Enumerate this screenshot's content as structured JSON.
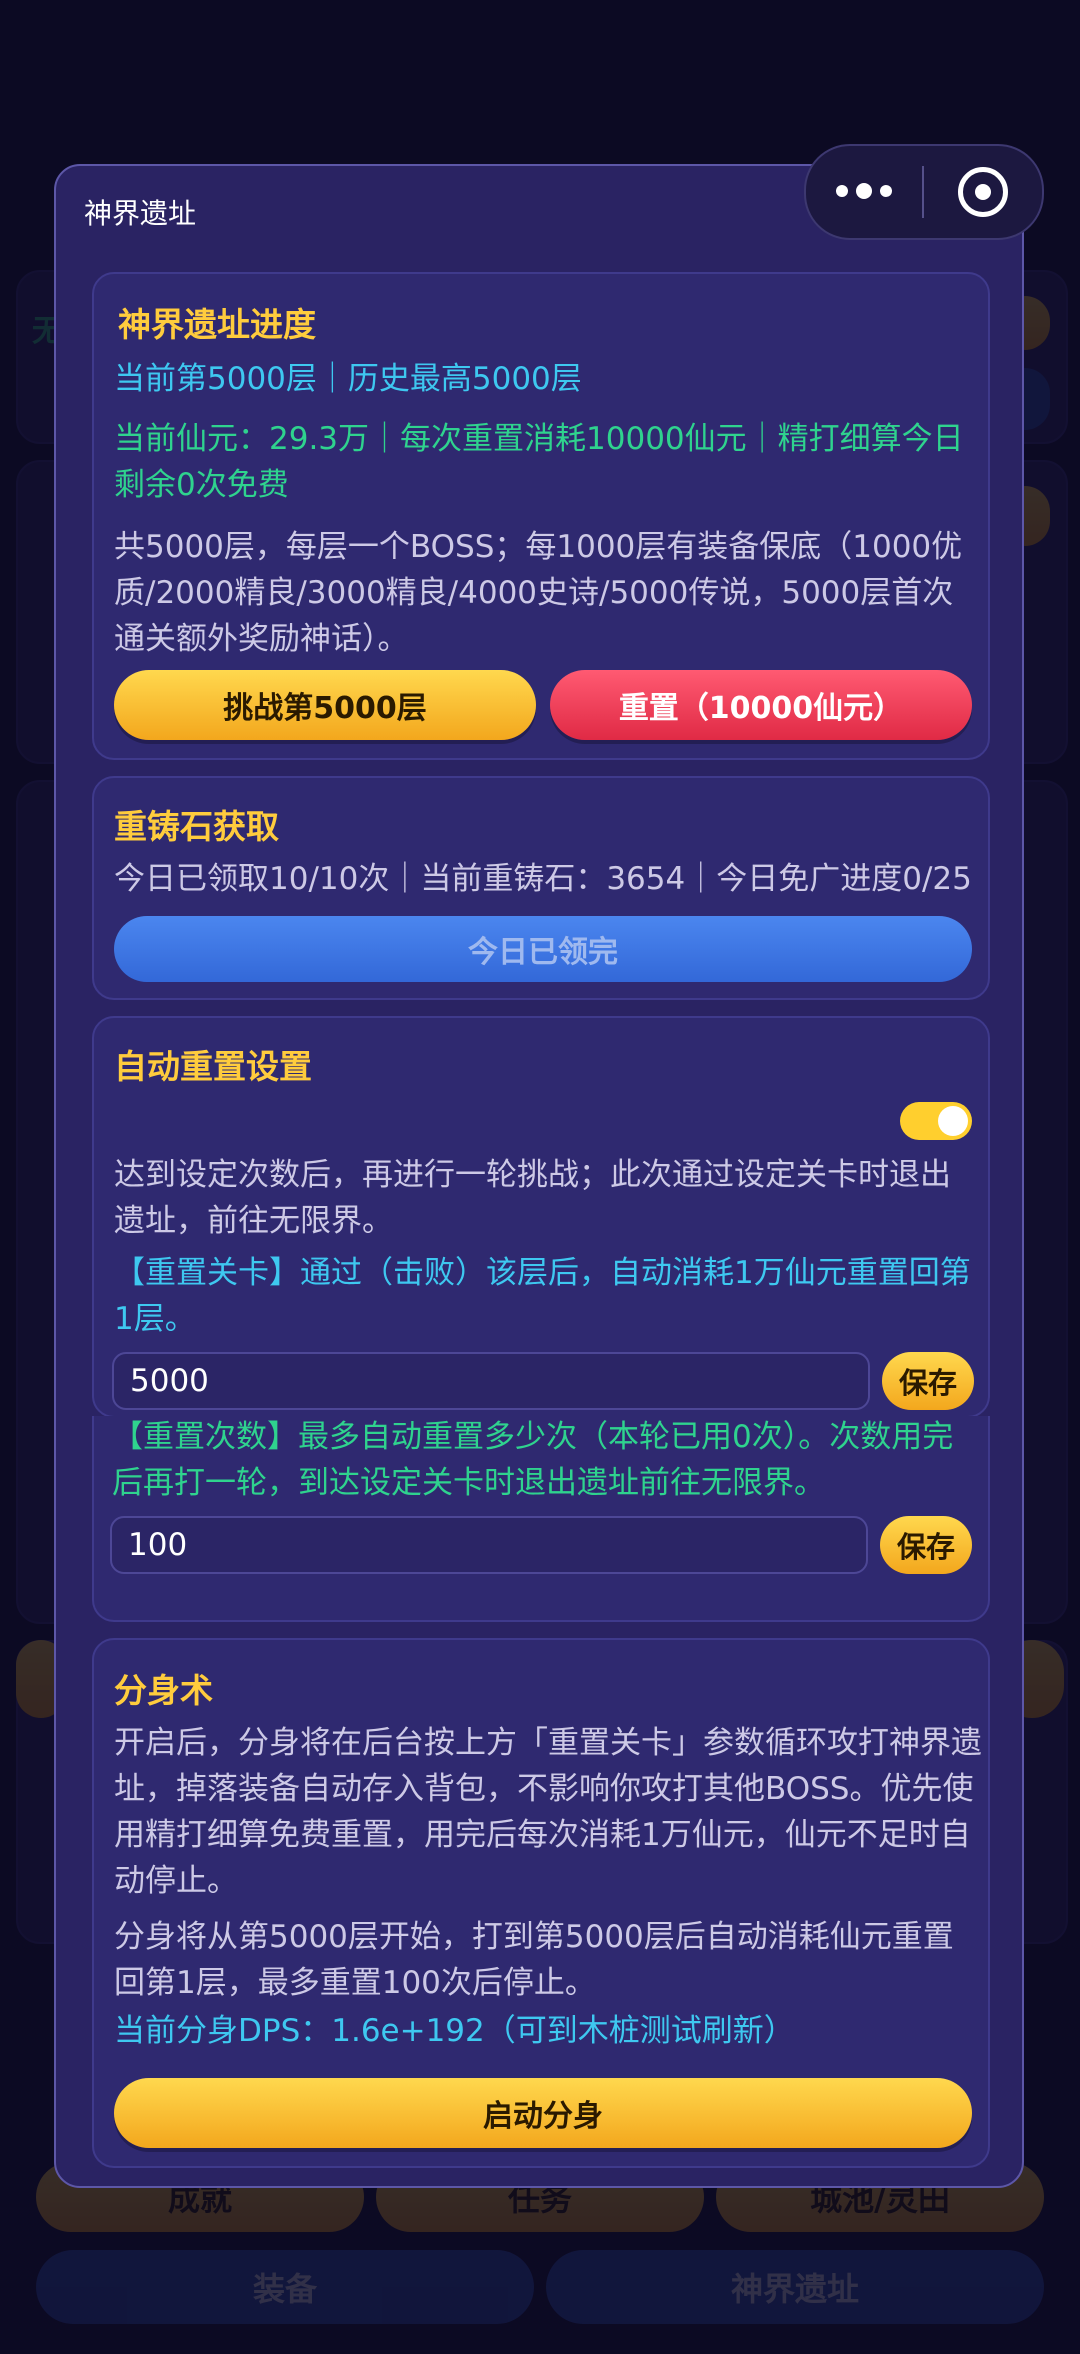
{
  "background": {
    "peek_left_top": "无",
    "bottom_row_1": [
      "成就",
      "任务",
      "城池/灵田"
    ],
    "bottom_row_2": [
      "装备",
      "神界遗址"
    ]
  },
  "capsule": {
    "more_icon": "more-dots-icon",
    "close_icon": "target-close-icon"
  },
  "modal": {
    "title": "神界遗址",
    "progress": {
      "title": "神界遗址进度",
      "floor_line": "当前第5000层｜历史最高5000层",
      "currency_line": "当前仙元：29.3万｜每次重置消耗10000仙元｜精打细算今日剩余0次免费",
      "desc": "共5000层，每层一个BOSS；每1000层有装备保底（1000优质/2000精良/3000精良/4000史诗/5000传说，5000层首次通关额外奖励神话）。",
      "challenge_button": "挑战第5000层",
      "reset_button": "重置（10000仙元）"
    },
    "reforge": {
      "title": "重铸石获取",
      "info_line": "今日已领取10/10次｜当前重铸石：3654｜今日免广进度0/25",
      "claim_button": "今日已领完"
    },
    "auto_reset": {
      "title": "自动重置设置",
      "toggle_on": true,
      "desc": "达到设定次数后，再进行一轮挑战；此次通过设定关卡时退出遗址，前往无限界。",
      "stage_desc": "【重置关卡】通过（击败）该层后，自动消耗1万仙元重置回第1层。",
      "stage_value": "5000",
      "save_label_1": "保存",
      "count_desc": "【重置次数】最多自动重置多少次（本轮已用0次）。次数用完后再打一轮，到达设定关卡时退出遗址前往无限界。",
      "count_value": "100",
      "save_label_2": "保存"
    },
    "clone": {
      "title": "分身术",
      "desc1": "开启后，分身将在后台按上方「重置关卡」参数循环攻打神界遗址，掉落装备自动存入背包，不影响你攻打其他BOSS。优先使用精打细算免费重置，用完后每次消耗1万仙元，仙元不足时自动停止。",
      "desc2": "分身将从第5000层开始，打到第5000层后自动消耗仙元重置回第1层，最多重置100次后停止。",
      "dps_line": "当前分身DPS：1.6e+192（可到木桩测试刷新）",
      "start_button": "启动分身"
    }
  }
}
